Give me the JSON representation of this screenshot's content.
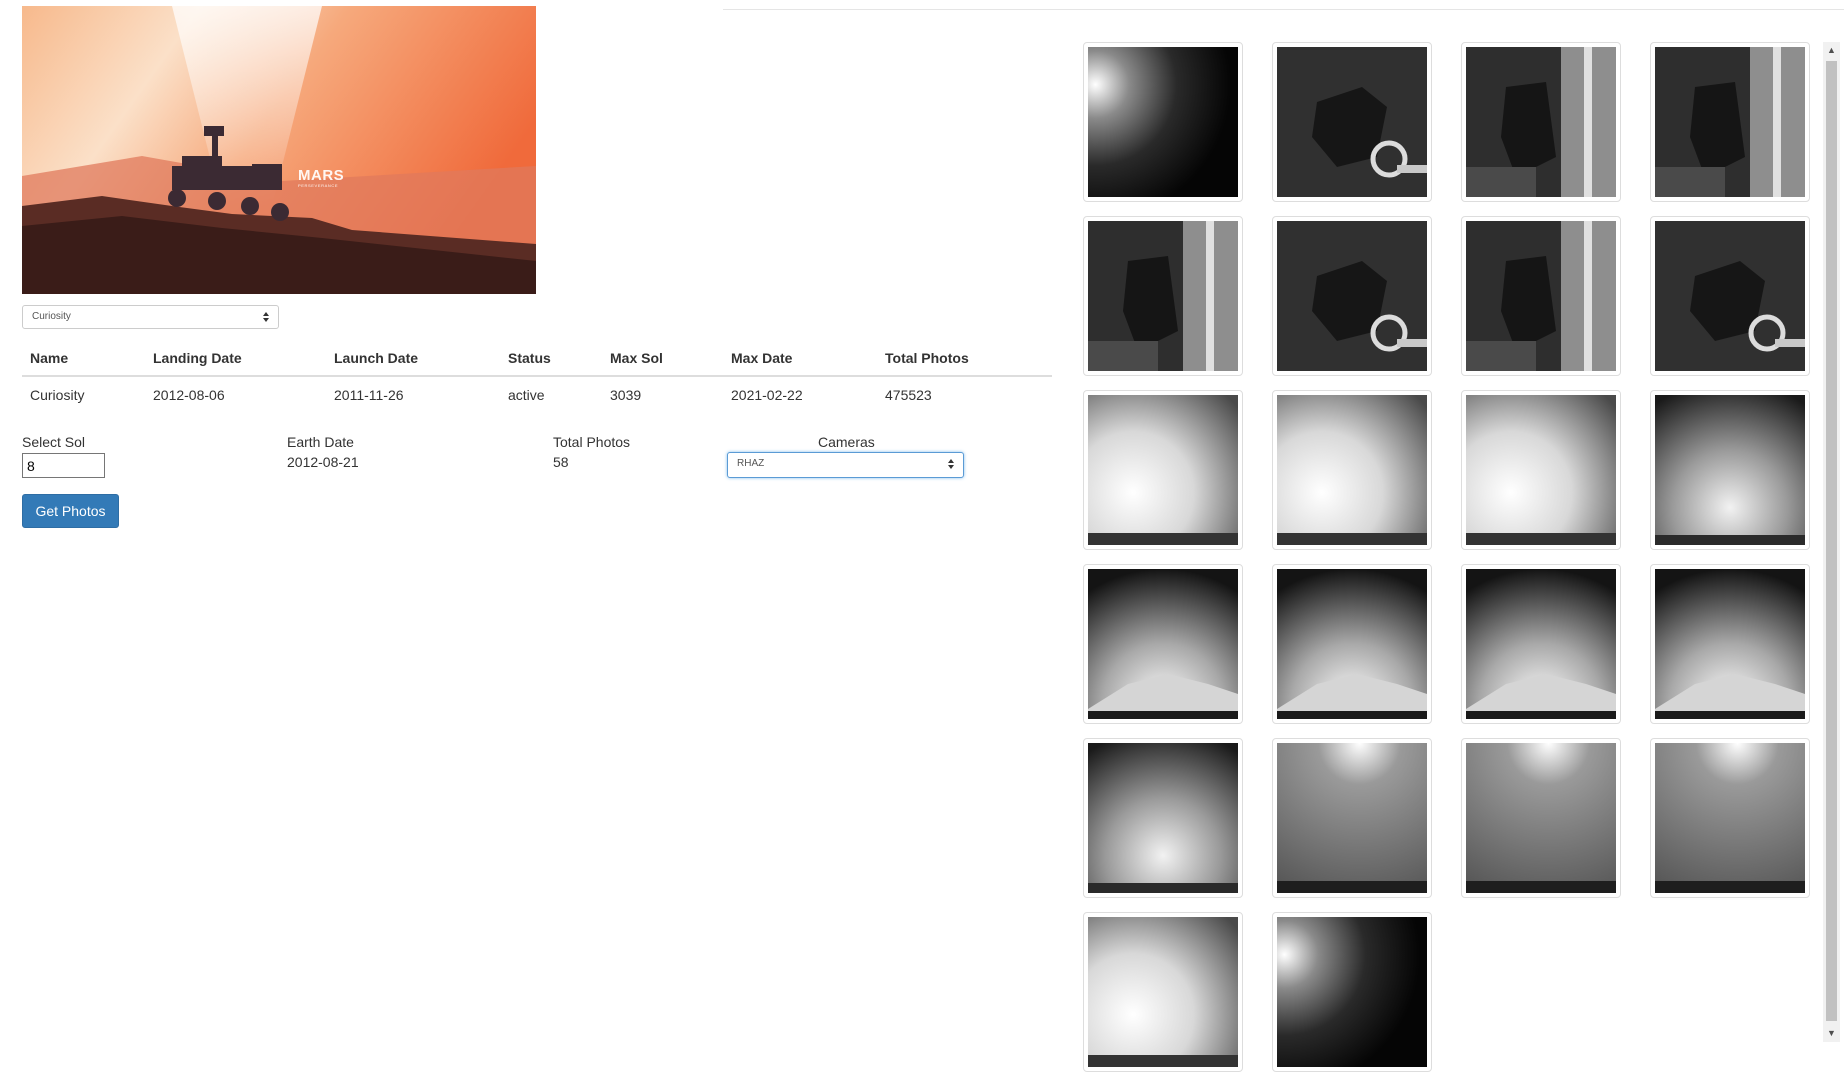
{
  "hero": {
    "title": "MARS",
    "subtitle": "PERSEVERANCE"
  },
  "rover_select": {
    "selected": "Curiosity"
  },
  "rover_table": {
    "headers": [
      "Name",
      "Landing Date",
      "Launch Date",
      "Status",
      "Max Sol",
      "Max Date",
      "Total Photos"
    ],
    "row": [
      "Curiosity",
      "2012-08-06",
      "2011-11-26",
      "active",
      "3039",
      "2021-02-22",
      "475523"
    ]
  },
  "controls": {
    "sol_label": "Select Sol",
    "sol_value": "8",
    "earth_date_label": "Earth Date",
    "earth_date_value": "2012-08-21",
    "total_photos_label": "Total Photos",
    "total_photos_value": "58",
    "cameras_label": "Cameras",
    "camera_selected": "RHAZ",
    "get_photos_label": "Get Photos"
  },
  "photo_grid": {
    "columns": 4,
    "count_shown": 22,
    "image_types": [
      "dark-flare",
      "rover-arm",
      "rover-mast",
      "rover-mast",
      "rover-mast",
      "rover-arm",
      "rover-mast",
      "rover-arm",
      "bright-sky",
      "bright-sky",
      "bright-sky",
      "dark-sky",
      "mountain",
      "mountain",
      "mountain",
      "mountain",
      "dark-sky",
      "hazy-sky",
      "hazy-sky",
      "hazy-sky",
      "bright-sky",
      "dark-flare"
    ]
  },
  "colors": {
    "primary_button": "#337ab7",
    "focus_border": "#5b9bd5",
    "mars_orange": "#f26b3a"
  }
}
